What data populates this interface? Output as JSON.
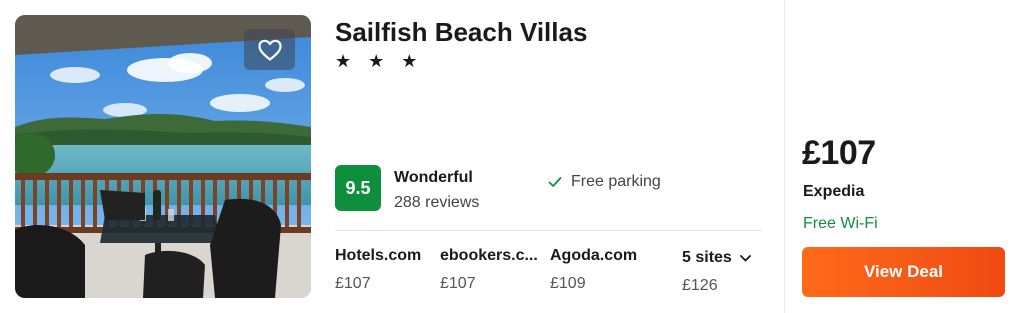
{
  "hotel": {
    "name": "Sailfish Beach Villas",
    "stars": "★ ★ ★",
    "rating": {
      "score": "9.5",
      "label": "Wonderful",
      "reviews": "288 reviews",
      "badge_color": "#0e8f3e"
    },
    "amenity": {
      "icon": "check-icon",
      "label": "Free parking"
    },
    "favorite_icon": "heart-icon"
  },
  "sites": [
    {
      "name": "Hotels.com",
      "price": "£107"
    },
    {
      "name": "ebookers.c...",
      "price": "£107"
    },
    {
      "name": "Agoda.com",
      "price": "£109"
    },
    {
      "name": "5 sites",
      "price": "£126",
      "icon": "chevron-down-icon"
    }
  ],
  "deal": {
    "price": "£107",
    "provider": "Expedia",
    "perk": "Free Wi-Fi",
    "perk_color": "#0e8f3e",
    "button_label": "View Deal",
    "button_color": "#f04a12"
  }
}
